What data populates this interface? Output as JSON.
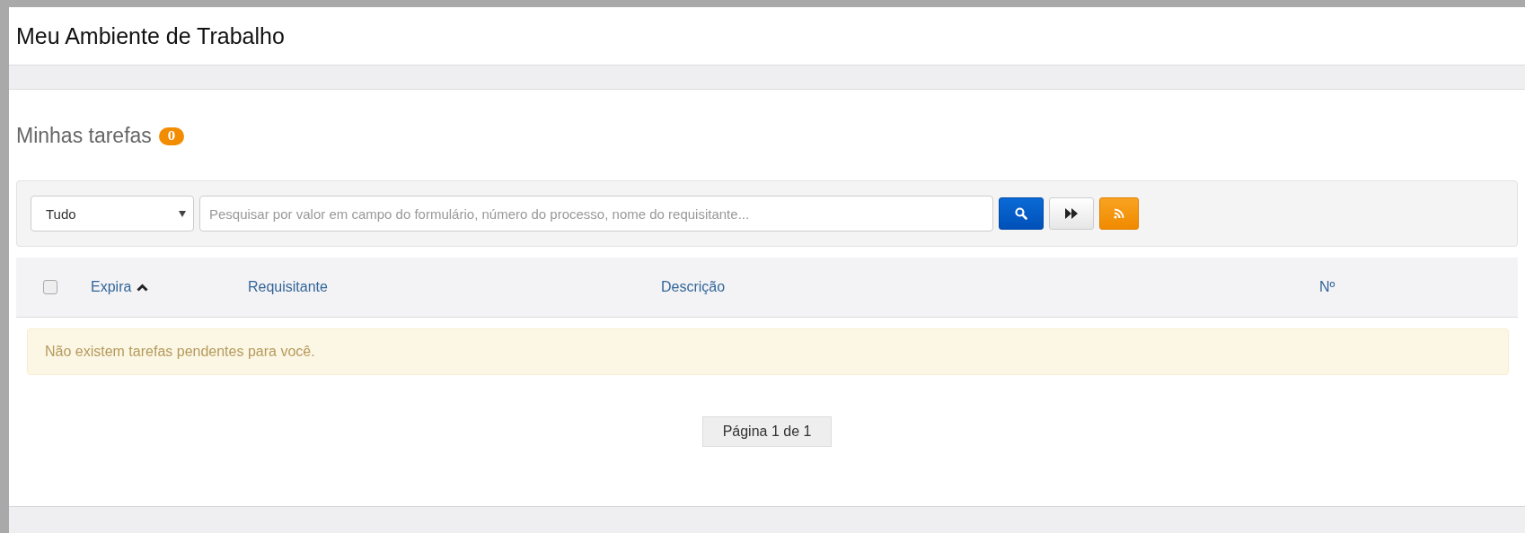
{
  "page_title": "Meu Ambiente de Trabalho",
  "tasks": {
    "title": "Minhas tarefas",
    "count": "0",
    "filter": {
      "value": "Tudo"
    },
    "search": {
      "placeholder": "Pesquisar por valor em campo do formulário, número do processo, nome do requisitante..."
    },
    "table": {
      "select_all": {
        "checked": false
      },
      "columns": [
        {
          "label": "Expira",
          "sorted": true
        },
        {
          "label": "Requisitante",
          "sorted": false
        },
        {
          "label": "Descrição",
          "sorted": false
        },
        {
          "label": "Nº",
          "sorted": false
        }
      ]
    },
    "empty_message": "Não existem tarefas pendentes para você.",
    "pagination": "Página 1 de 1"
  }
}
